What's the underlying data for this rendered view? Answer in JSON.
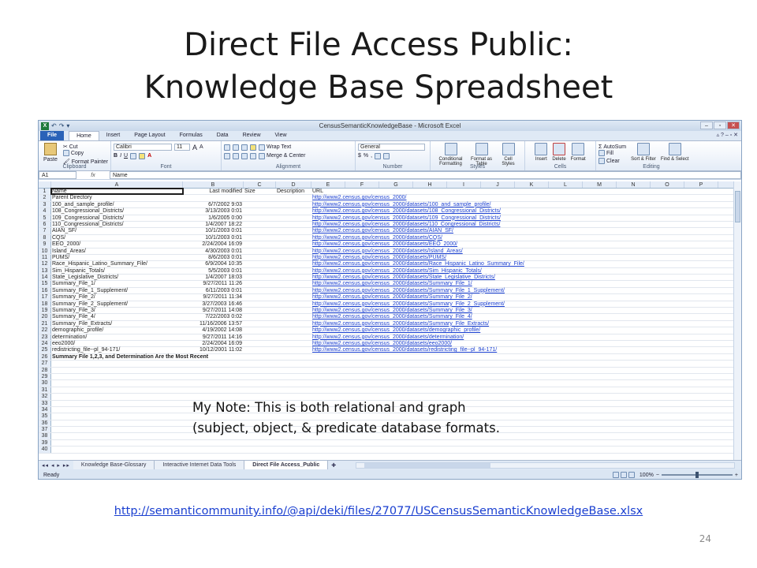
{
  "slide": {
    "title_line1": "Direct File Access Public:",
    "title_line2": "Knowledge Base Spreadsheet",
    "note_line1": "My Note: This is both relational and graph",
    "note_line2": "(subject, object, & predicate database formats.",
    "footer_link": "http://semanticommunity.info/@api/deki/files/27077/USCensusSemanticKnowledgeBase.xlsx",
    "page_number": "24"
  },
  "excel": {
    "window_title": "CensusSemanticKnowledgeBase - Microsoft Excel",
    "qat": [
      "↶",
      "↷",
      "▾"
    ],
    "tabs": [
      "File",
      "Home",
      "Insert",
      "Page Layout",
      "Formulas",
      "Data",
      "Review",
      "View"
    ],
    "ribbon": {
      "clipboard": {
        "label": "Clipboard",
        "paste": "Paste",
        "cut": "Cut",
        "copy": "Copy",
        "format_painter": "Format Painter"
      },
      "font": {
        "label": "Font",
        "font_name": "Calibri",
        "font_size": "11",
        "grow": "A",
        "shrink": "A"
      },
      "alignment": {
        "label": "Alignment",
        "wrap": "Wrap Text",
        "merge": "Merge & Center"
      },
      "number": {
        "label": "Number",
        "format": "General",
        "currency": "$",
        "percent": "%",
        "comma": ","
      },
      "styles": {
        "label": "Styles",
        "conditional": "Conditional Formatting",
        "format_table": "Format as Table",
        "cell_styles": "Cell Styles"
      },
      "cells": {
        "label": "Cells",
        "insert": "Insert",
        "delete": "Delete",
        "format": "Format"
      },
      "editing": {
        "label": "Editing",
        "autosum": "AutoSum",
        "fill": "Fill",
        "clear": "Clear",
        "sort": "Sort & Filter",
        "find": "Find & Select"
      }
    },
    "name_box": "A1",
    "fx": "fx",
    "formula_value": "Name",
    "columns": [
      "A",
      "B",
      "C",
      "D",
      "E",
      "F",
      "G",
      "H",
      "I",
      "J",
      "K",
      "L",
      "M",
      "N",
      "O",
      "P"
    ],
    "rows": [
      {
        "n": "1",
        "a": "Name",
        "b": "Last modified",
        "c": "Size",
        "d": "Description",
        "e": "URL"
      },
      {
        "n": "2",
        "a": "Parent Directory",
        "b": "",
        "c": "",
        "d": "",
        "e": "http://www2.census.gov/census_2000/"
      },
      {
        "n": "3",
        "a": "100_and_sample_profile/",
        "b": "6/7/2002 9:03",
        "c": "",
        "d": "",
        "e": "http://www2.census.gov/census_2000/datasets/100_and_sample_profile/"
      },
      {
        "n": "4",
        "a": "108_Congressional_Districts/",
        "b": "3/13/2003 0:01",
        "c": "",
        "d": "",
        "e": "http://www2.census.gov/census_2000/datasets/108_Congressional_Districts/"
      },
      {
        "n": "5",
        "a": "109_Congressional_Districts/",
        "b": "1/6/2005 0:00",
        "c": "",
        "d": "",
        "e": "http://www2.census.gov/census_2000/datasets/109_Congressional_Districts/"
      },
      {
        "n": "6",
        "a": "110_Congressional_Districts/",
        "b": "1/4/2007 18:22",
        "c": "",
        "d": "",
        "e": "http://www2.census.gov/census_2000/datasets/110_Congressional_Districts/"
      },
      {
        "n": "7",
        "a": "AIAN_SF/",
        "b": "10/1/2003 0:01",
        "c": "",
        "d": "",
        "e": "http://www2.census.gov/census_2000/datasets/AIAN_SF/"
      },
      {
        "n": "8",
        "a": "CQS/",
        "b": "10/1/2003 0:01",
        "c": "",
        "d": "",
        "e": "http://www2.census.gov/census_2000/datasets/CQS/"
      },
      {
        "n": "9",
        "a": "EEO_2000/",
        "b": "2/24/2004 16:09",
        "c": "",
        "d": "",
        "e": "http://www2.census.gov/census_2000/datasets/EEO_2000/"
      },
      {
        "n": "10",
        "a": "Island_Areas/",
        "b": "4/30/2003 0:01",
        "c": "",
        "d": "",
        "e": "http://www2.census.gov/census_2000/datasets/Island_Areas/"
      },
      {
        "n": "11",
        "a": "PUMS/",
        "b": "8/6/2003 0:01",
        "c": "",
        "d": "",
        "e": "http://www2.census.gov/census_2000/datasets/PUMS/"
      },
      {
        "n": "12",
        "a": "Race_Hispanic_Latino_Summary_File/",
        "b": "6/9/2004 10:35",
        "c": "",
        "d": "",
        "e": "http://www2.census.gov/census_2000/datasets/Race_Hispanic_Latino_Summary_File/"
      },
      {
        "n": "13",
        "a": "Sim_Hispanic_Totals/",
        "b": "5/5/2003 0:01",
        "c": "",
        "d": "",
        "e": "http://www2.census.gov/census_2000/datasets/Sim_Hispanic_Totals/"
      },
      {
        "n": "14",
        "a": "State_Legislative_Districts/",
        "b": "1/4/2007 18:03",
        "c": "",
        "d": "",
        "e": "http://www2.census.gov/census_2000/datasets/State_Legislative_Districts/"
      },
      {
        "n": "15",
        "a": "Summary_File_1/",
        "b": "9/27/2011 11:26",
        "c": "",
        "d": "",
        "e": "http://www2.census.gov/census_2000/datasets/Summary_File_1/"
      },
      {
        "n": "16",
        "a": "Summary_File_1_Supplement/",
        "b": "6/11/2003 0:01",
        "c": "",
        "d": "",
        "e": "http://www2.census.gov/census_2000/datasets/Summary_File_1_Supplement/"
      },
      {
        "n": "17",
        "a": "Summary_File_2/",
        "b": "9/27/2011 11:34",
        "c": "",
        "d": "",
        "e": "http://www2.census.gov/census_2000/datasets/Summary_File_2/"
      },
      {
        "n": "18",
        "a": "Summary_File_2_Supplement/",
        "b": "3/27/2003 16:46",
        "c": "",
        "d": "",
        "e": "http://www2.census.gov/census_2000/datasets/Summary_File_2_Supplement/"
      },
      {
        "n": "19",
        "a": "Summary_File_3/",
        "b": "9/27/2011 14:08",
        "c": "",
        "d": "",
        "e": "http://www2.census.gov/census_2000/datasets/Summary_File_3/"
      },
      {
        "n": "20",
        "a": "Summary_File_4/",
        "b": "7/22/2003 0:02",
        "c": "",
        "d": "",
        "e": "http://www2.census.gov/census_2000/datasets/Summary_File_4/"
      },
      {
        "n": "21",
        "a": "Summary_File_Extracts/",
        "b": "11/16/2006 13:57",
        "c": "",
        "d": "",
        "e": "http://www2.census.gov/census_2000/datasets/Summary_File_Extracts/"
      },
      {
        "n": "22",
        "a": "demographic_profile/",
        "b": "4/19/2002 14:08",
        "c": "",
        "d": "",
        "e": "http://www2.census.gov/census_2000/datasets/demographic_profile/"
      },
      {
        "n": "23",
        "a": "determination/",
        "b": "9/27/2011 14:16",
        "c": "",
        "d": "",
        "e": "http://www2.census.gov/census_2000/datasets/determination/"
      },
      {
        "n": "24",
        "a": "eeo2000/",
        "b": "2/24/2004 16:09",
        "c": "",
        "d": "",
        "e": "http://www2.census.gov/census_2000/datasets/eeo2000/"
      },
      {
        "n": "25",
        "a": "redistricting_file--pl_94-171/",
        "b": "10/12/2001 11:02",
        "c": "",
        "d": "",
        "e": "http://www2.census.gov/census_2000/datasets/redistricting_file--pl_94-171/"
      },
      {
        "n": "26",
        "a": "Summary File 1,2,3, and Determination Are the Most Recent",
        "b": "",
        "c": "",
        "d": "",
        "e": ""
      },
      {
        "n": "27",
        "a": "",
        "b": "",
        "c": "",
        "d": "",
        "e": ""
      },
      {
        "n": "28",
        "a": "",
        "b": "",
        "c": "",
        "d": "",
        "e": ""
      },
      {
        "n": "29",
        "a": "",
        "b": "",
        "c": "",
        "d": "",
        "e": ""
      },
      {
        "n": "30",
        "a": "",
        "b": "",
        "c": "",
        "d": "",
        "e": ""
      },
      {
        "n": "31",
        "a": "",
        "b": "",
        "c": "",
        "d": "",
        "e": ""
      },
      {
        "n": "32",
        "a": "",
        "b": "",
        "c": "",
        "d": "",
        "e": ""
      },
      {
        "n": "33",
        "a": "",
        "b": "",
        "c": "",
        "d": "",
        "e": ""
      },
      {
        "n": "34",
        "a": "",
        "b": "",
        "c": "",
        "d": "",
        "e": ""
      },
      {
        "n": "35",
        "a": "",
        "b": "",
        "c": "",
        "d": "",
        "e": ""
      },
      {
        "n": "36",
        "a": "",
        "b": "",
        "c": "",
        "d": "",
        "e": ""
      },
      {
        "n": "37",
        "a": "",
        "b": "",
        "c": "",
        "d": "",
        "e": ""
      },
      {
        "n": "38",
        "a": "",
        "b": "",
        "c": "",
        "d": "",
        "e": ""
      },
      {
        "n": "39",
        "a": "",
        "b": "",
        "c": "",
        "d": "",
        "e": ""
      },
      {
        "n": "40",
        "a": "",
        "b": "",
        "c": "",
        "d": "",
        "e": ""
      }
    ],
    "sheet_tabs": [
      "Knowledge Base-Glossary",
      "Interactive Internet Data Tools",
      "Direct File Access_Public"
    ],
    "active_sheet_index": 2,
    "status": {
      "ready": "Ready",
      "zoom": "100%",
      "minus": "−",
      "plus": "+"
    }
  }
}
